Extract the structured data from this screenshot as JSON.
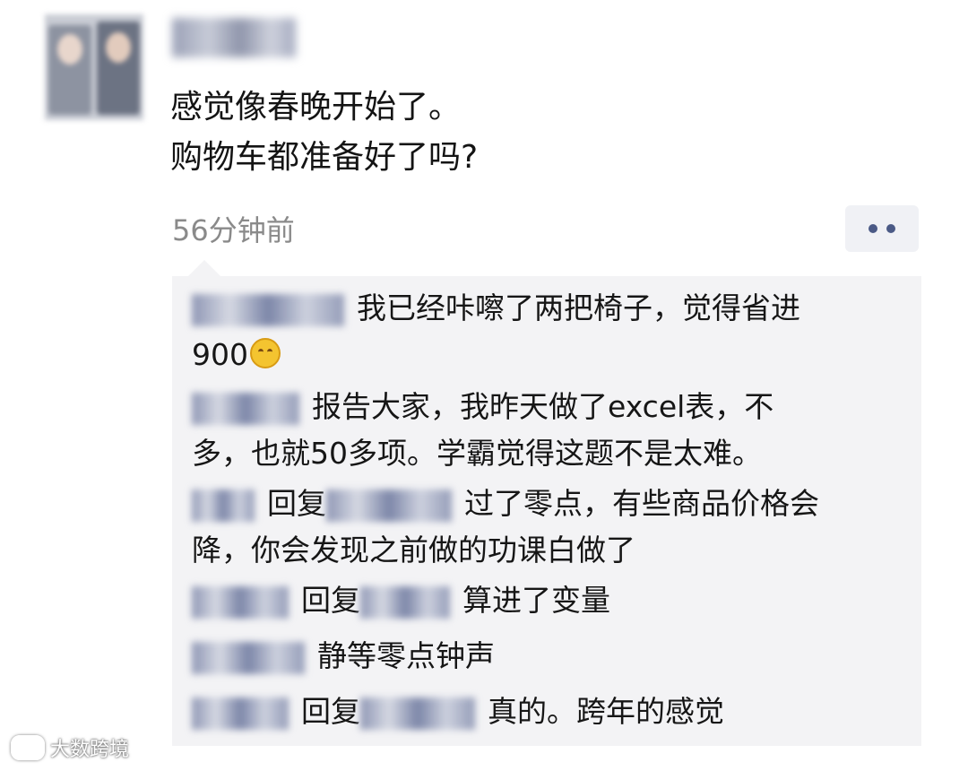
{
  "post": {
    "lines": [
      "感觉像春晚开始了。",
      "购物车都准备好了吗?"
    ],
    "time": "56分钟前"
  },
  "comments": [
    {
      "lines": [
        "我已经咔嚓了两把椅子，觉得省进",
        "900"
      ],
      "emoji": "grin-emoji"
    },
    {
      "lines": [
        "报告大家，我昨天做了excel表，不",
        "多，也就50多项。学霸觉得这题不是太难。"
      ]
    },
    {
      "reply_word": "回复",
      "lines": [
        "过了零点，有些商品价格会",
        "降，你会发现之前做的功课白做了"
      ]
    },
    {
      "reply_word": "回复",
      "lines": [
        "算进了变量"
      ]
    },
    {
      "lines": [
        "静等零点钟声"
      ]
    },
    {
      "reply_word": "回复",
      "lines": [
        "真的。跨年的感觉"
      ]
    }
  ],
  "watermark": "大数跨境",
  "colors": {
    "comment_bg": "#f3f3f5",
    "time": "#8a8a8a",
    "dots": "#4b5a86"
  }
}
